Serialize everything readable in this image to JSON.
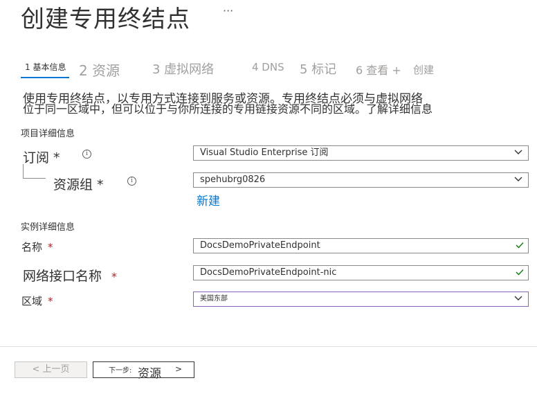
{
  "header": {
    "title": "创建专用终结点",
    "more": "···"
  },
  "steps": [
    {
      "label": "1 基本信息"
    },
    {
      "label": "2 资源"
    },
    {
      "label": "3 虚拟网络"
    },
    {
      "label": "4 DNS"
    },
    {
      "label": "5 标记"
    },
    {
      "label": "6 查看 +"
    },
    {
      "label": "创建"
    }
  ],
  "description": {
    "line1": "使用专用终结点，以专用方式连接到服务或资源。专用终结点必须与虚拟网络",
    "line2": "位于同一区域中，但可以位于与你所连接的专用链接资源不同的区域。了解详细信息"
  },
  "project_details": {
    "heading": "项目详细信息",
    "subscription": {
      "label": "订阅 *",
      "value": "Visual  Studio  Enterprise 订阅"
    },
    "resource_group": {
      "label": "资源组 *",
      "value": "spehubrg0826",
      "create_new": "新建"
    }
  },
  "instance_details": {
    "heading": "实例详细信息",
    "name": {
      "label": "名称",
      "value": "DocsDemoPrivateEndpoint"
    },
    "nic_name": {
      "label": "网络接口名称",
      "value": "DocsDemoPrivateEndpoint-nic"
    },
    "region": {
      "label": "区域",
      "value": "美国东部"
    }
  },
  "required_mark": "*",
  "info_glyph": "i",
  "footer": {
    "prev_label": "< 上一页",
    "next_prefix": "下一步:",
    "next_target": "资源",
    "next_arrow": ">"
  },
  "colors": {
    "accent": "#0078d4",
    "required": "#a4262c",
    "valid_check": "#107c10",
    "focus_border": "#8764b8"
  }
}
